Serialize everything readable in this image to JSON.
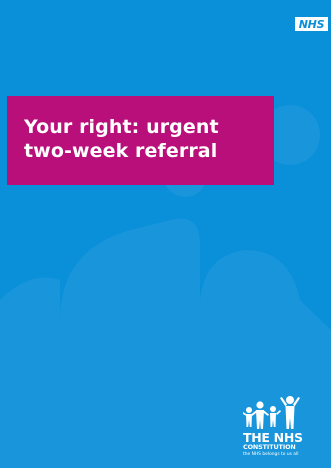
{
  "colors": {
    "background": "#0a8fd9",
    "title_box": "#b80f7a",
    "text": "#ffffff"
  },
  "brand": {
    "logo_text": "NHS"
  },
  "title": {
    "line1": "Your right: urgent",
    "line2": "two-week referral"
  },
  "constitution": {
    "icon": "family-figures-icon",
    "title": "THE NHS",
    "subtitle": "CONSTITUTION",
    "tagline": "the NHS belongs to us all"
  }
}
